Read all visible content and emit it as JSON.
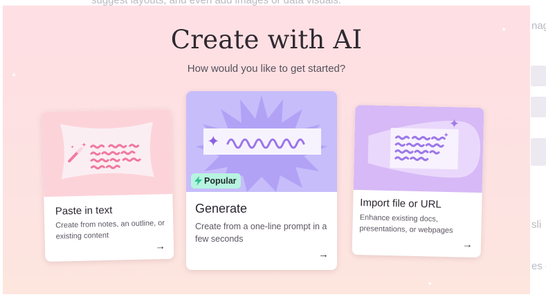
{
  "background_page": {
    "top_text": "suggest layouts, and even add images or data visuals.",
    "right_fragment_1": "nag",
    "right_fragment_2": "sli",
    "right_fragment_3": "es c"
  },
  "modal": {
    "title": "Create with AI",
    "subtitle": "How would you like to get started?",
    "cards": [
      {
        "title": "Paste in text",
        "description": "Create from notes, an outline, or existing content",
        "arrow": "→",
        "icon": "magic-wand-icon",
        "art_color": "#fdd3da"
      },
      {
        "title": "Generate",
        "description": "Create from a one-line prompt in a few seconds",
        "arrow": "→",
        "badge": "Popular",
        "badge_icon": "lightning-icon",
        "art_color": "#c6bdfa"
      },
      {
        "title": "Import file or URL",
        "description": "Enhance existing docs, presentations, or webpages",
        "arrow": "→",
        "icon": "sparkle-icon",
        "art_color": "#d6b9f6"
      }
    ]
  },
  "colors": {
    "overlay_top": "#fedfe4",
    "overlay_bottom": "#fde6de",
    "popular_badge": "#b7f4e0",
    "title_text": "#2f2a30"
  }
}
